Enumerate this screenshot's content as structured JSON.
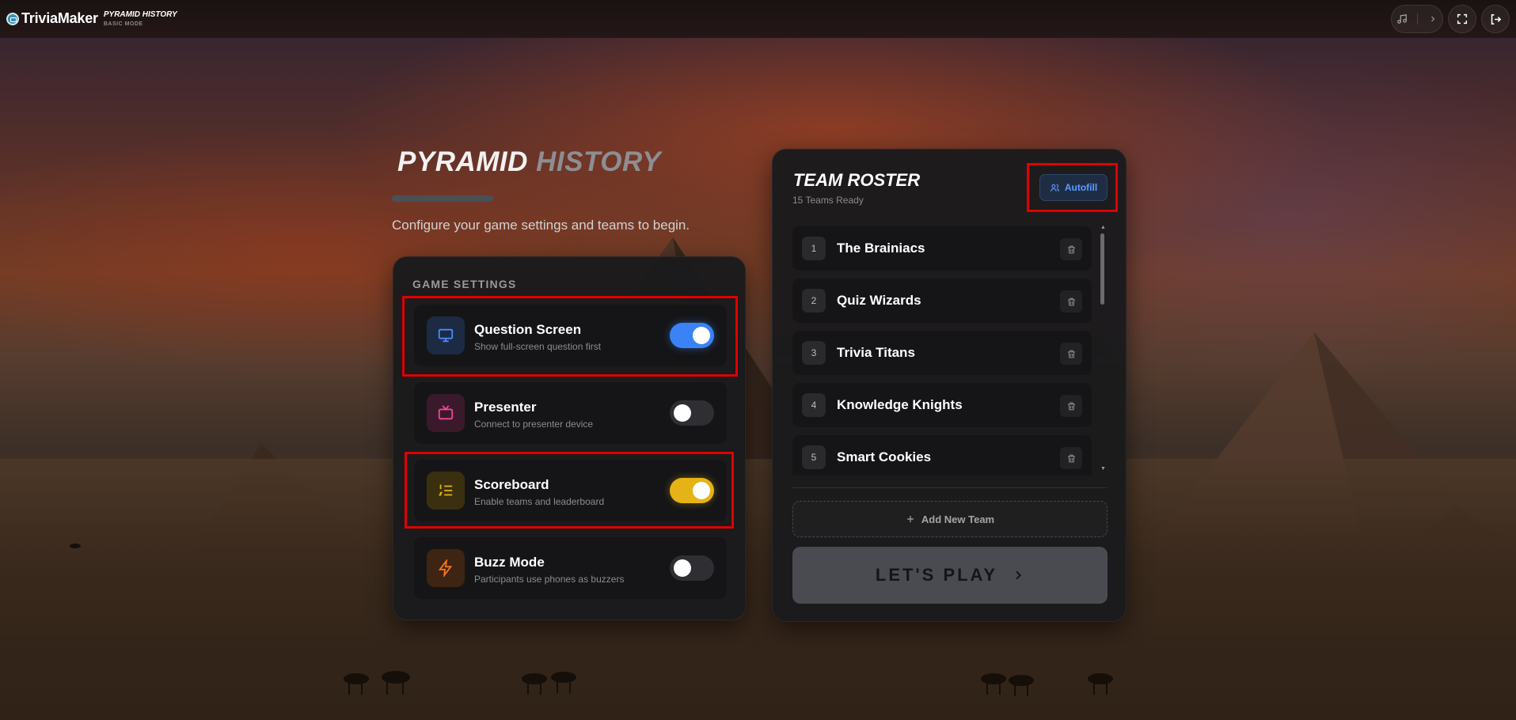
{
  "brand": {
    "name": "TriviaMaker",
    "game_title": "PYRAMID HISTORY",
    "mode": "BASIC MODE"
  },
  "icons": {
    "logo": "trivia-monitor-icon",
    "music": "music-note-icon",
    "expand": "chevron-right-icon",
    "fullscreen": "fullscreen-icon",
    "exit": "logout-icon"
  },
  "hero": {
    "title_part1": "PYRAMID",
    "title_part2": "HISTORY",
    "subtitle": "Configure your game settings and teams to begin."
  },
  "settings": {
    "heading": "GAME SETTINGS",
    "items": [
      {
        "name": "Question Screen",
        "description": "Show full-screen question first",
        "enabled": true,
        "icon": "monitor-icon",
        "accent": "#3b82f6"
      },
      {
        "name": "Presenter",
        "description": "Connect to presenter device",
        "enabled": false,
        "icon": "tv-icon",
        "accent": "#ec4899"
      },
      {
        "name": "Scoreboard",
        "description": "Enable teams and leaderboard",
        "enabled": true,
        "icon": "list-ordered-icon",
        "accent": "#e6b316"
      },
      {
        "name": "Buzz Mode",
        "description": "Participants use phones as buzzers",
        "enabled": false,
        "icon": "lightning-icon",
        "accent": "#f97316"
      }
    ]
  },
  "roster": {
    "title": "TEAM ROSTER",
    "subtitle": "15 Teams Ready",
    "autofill_label": "Autofill",
    "teams": [
      {
        "number": "1",
        "name": "The Brainiacs"
      },
      {
        "number": "2",
        "name": "Quiz Wizards"
      },
      {
        "number": "3",
        "name": "Trivia Titans"
      },
      {
        "number": "4",
        "name": "Knowledge Knights"
      },
      {
        "number": "5",
        "name": "Smart Cookies"
      }
    ],
    "add_team_label": "Add New Team",
    "play_label": "LET'S PLAY"
  }
}
